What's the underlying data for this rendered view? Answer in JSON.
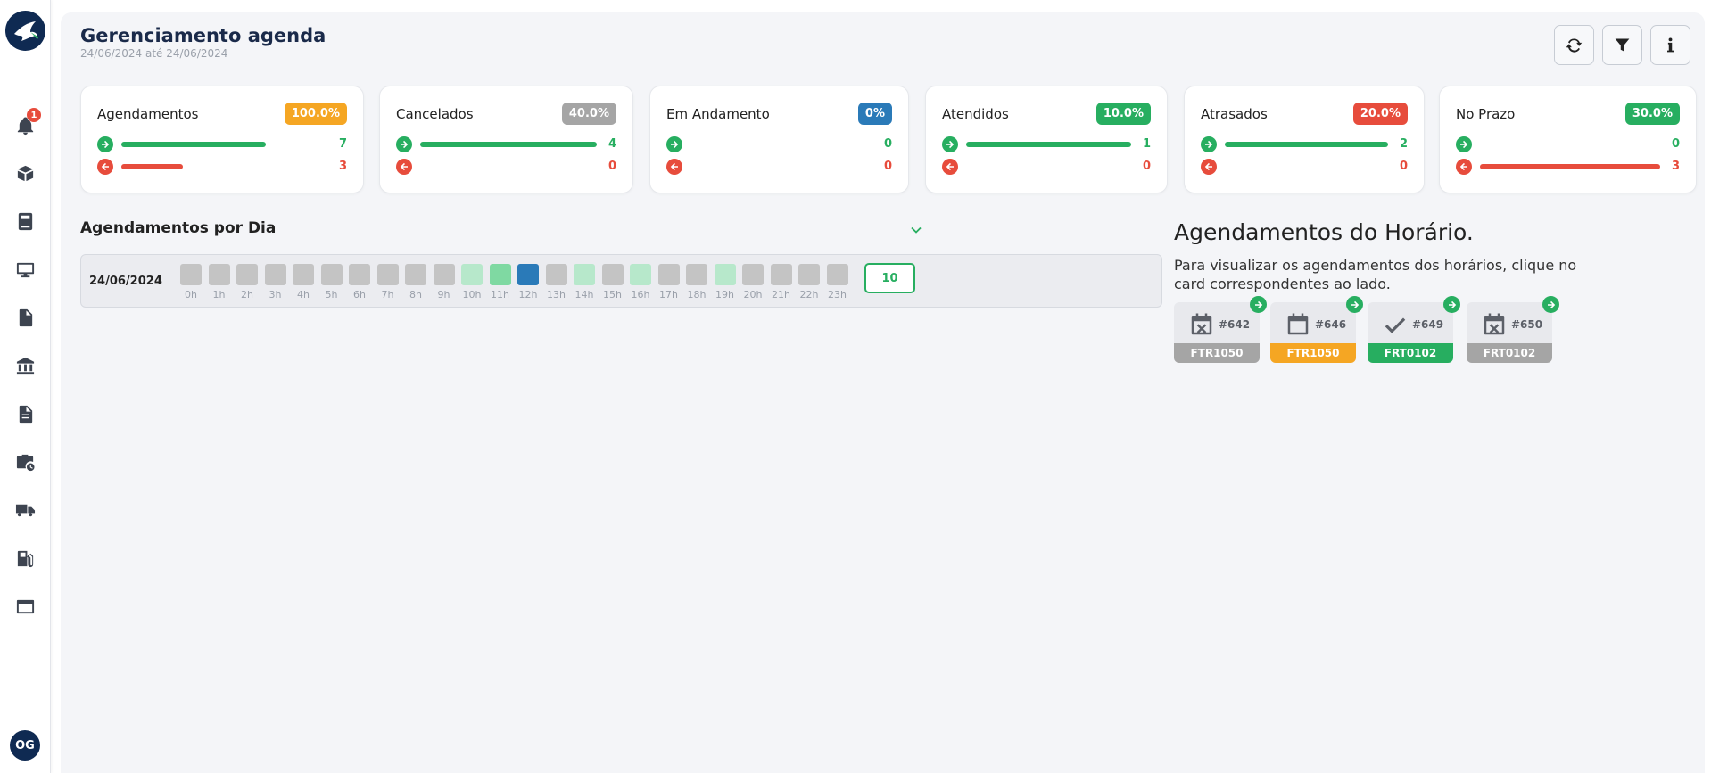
{
  "header": {
    "title": "Gerenciamento agenda",
    "date_range": "24/06/2024 até 24/06/2024"
  },
  "user": {
    "initials": "OG"
  },
  "notifications": {
    "count": "1"
  },
  "colors": {
    "green": "#27ae60",
    "red": "#e74c3c",
    "orange": "#f5a623",
    "gray": "#a5a5a5",
    "blue": "#2a7ab8",
    "navy": "#0f2a52"
  },
  "cards": [
    {
      "title": "Agendamentos",
      "percent": "100.0%",
      "pill_color": "#f5a623",
      "in_value": "7",
      "out_value": "3",
      "in_fill": 0.7,
      "out_fill": 0.3
    },
    {
      "title": "Cancelados",
      "percent": "40.0%",
      "pill_color": "#a5a5a5",
      "in_value": "4",
      "out_value": "0",
      "in_fill": 1.0,
      "out_fill": 0
    },
    {
      "title": "Em Andamento",
      "percent": "0%",
      "pill_color": "#2a7ab8",
      "in_value": "0",
      "out_value": "0",
      "in_fill": 0,
      "out_fill": 0
    },
    {
      "title": "Atendidos",
      "percent": "10.0%",
      "pill_color": "#27ae60",
      "in_value": "1",
      "out_value": "0",
      "in_fill": 1.0,
      "out_fill": 0
    },
    {
      "title": "Atrasados",
      "percent": "20.0%",
      "pill_color": "#e74c3c",
      "in_value": "2",
      "out_value": "0",
      "in_fill": 1.0,
      "out_fill": 0
    },
    {
      "title": "No Prazo",
      "percent": "30.0%",
      "pill_color": "#27ae60",
      "in_value": "0",
      "out_value": "3",
      "in_fill": 0,
      "out_fill": 1.0
    }
  ],
  "per_day": {
    "title": "Agendamentos por Dia",
    "date": "24/06/2024",
    "total": "10",
    "hours": [
      {
        "label": "0h",
        "color": "#c4c4c4"
      },
      {
        "label": "1h",
        "color": "#c4c4c4"
      },
      {
        "label": "2h",
        "color": "#c4c4c4"
      },
      {
        "label": "3h",
        "color": "#c4c4c4"
      },
      {
        "label": "4h",
        "color": "#c4c4c4"
      },
      {
        "label": "5h",
        "color": "#c4c4c4"
      },
      {
        "label": "6h",
        "color": "#c4c4c4"
      },
      {
        "label": "7h",
        "color": "#c4c4c4"
      },
      {
        "label": "8h",
        "color": "#c4c4c4"
      },
      {
        "label": "9h",
        "color": "#c4c4c4"
      },
      {
        "label": "10h",
        "color": "#b7e8cb"
      },
      {
        "label": "11h",
        "color": "#7fd9a2"
      },
      {
        "label": "12h",
        "color": "#2a7ab8"
      },
      {
        "label": "13h",
        "color": "#c4c4c4"
      },
      {
        "label": "14h",
        "color": "#b7e8cb"
      },
      {
        "label": "15h",
        "color": "#c4c4c4"
      },
      {
        "label": "16h",
        "color": "#b7e8cb"
      },
      {
        "label": "17h",
        "color": "#c4c4c4"
      },
      {
        "label": "18h",
        "color": "#c4c4c4"
      },
      {
        "label": "19h",
        "color": "#b7e8cb"
      },
      {
        "label": "20h",
        "color": "#c4c4c4"
      },
      {
        "label": "21h",
        "color": "#c4c4c4"
      },
      {
        "label": "22h",
        "color": "#c4c4c4"
      },
      {
        "label": "23h",
        "color": "#c4c4c4"
      }
    ]
  },
  "hour_panel": {
    "title": "Agendamentos do Horário.",
    "description": "Para visualizar os agendamentos dos horários, clique no card correspondentes ao lado.",
    "appointments": [
      {
        "number": "#642",
        "code": "FTR1050",
        "color": "#a5a5a5",
        "icon": "calendar-x-icon"
      },
      {
        "number": "#646",
        "code": "FTR1050",
        "color": "#f5a623",
        "icon": "calendar-icon"
      },
      {
        "number": "#649",
        "code": "FRT0102",
        "color": "#27ae60",
        "icon": "check-icon"
      },
      {
        "number": "#650",
        "code": "FRT0102",
        "color": "#a5a5a5",
        "icon": "calendar-x-icon"
      }
    ]
  }
}
